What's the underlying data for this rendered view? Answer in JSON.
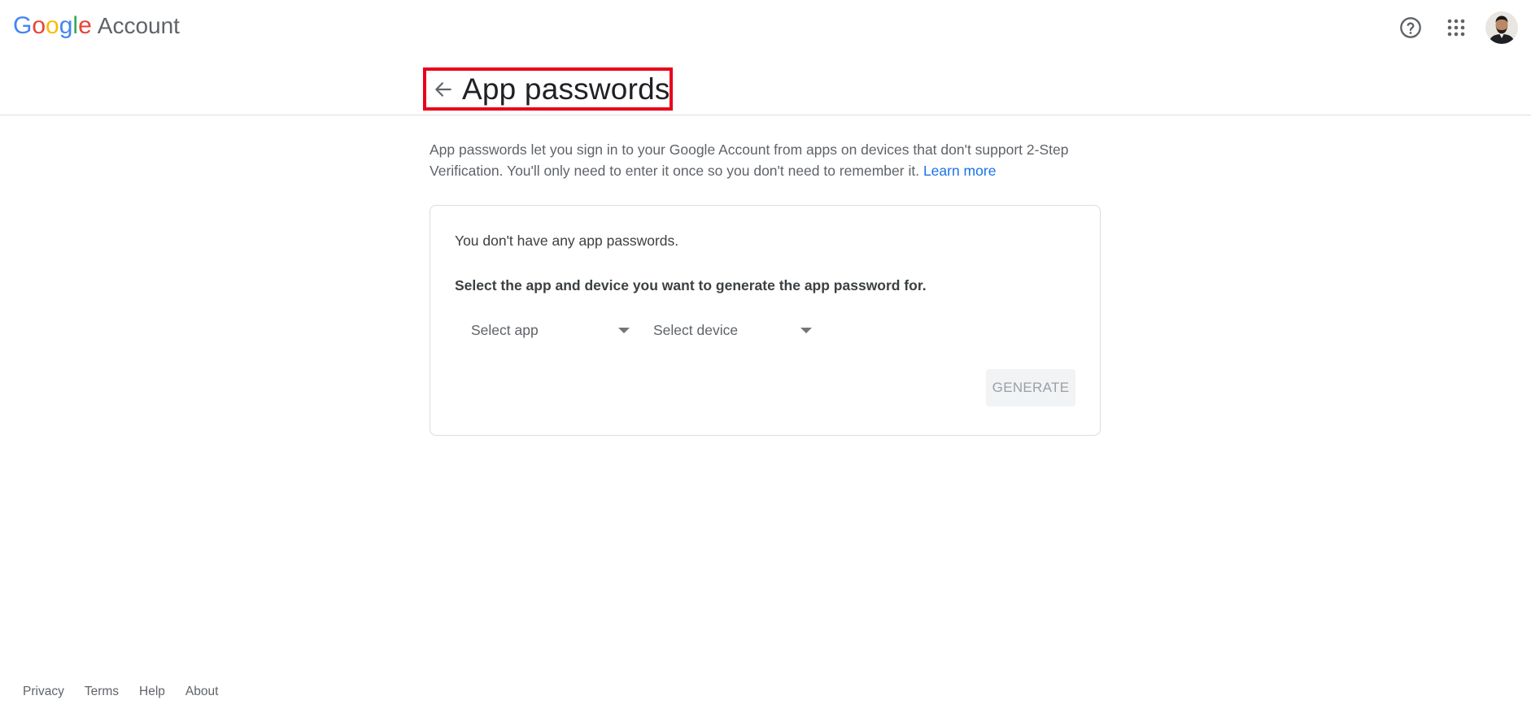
{
  "brand": {
    "letters": [
      {
        "char": "G",
        "color": "#4285F4"
      },
      {
        "char": "o",
        "color": "#EA4335"
      },
      {
        "char": "o",
        "color": "#FBBC05"
      },
      {
        "char": "g",
        "color": "#4285F4"
      },
      {
        "char": "l",
        "color": "#34A853"
      },
      {
        "char": "e",
        "color": "#EA4335"
      }
    ],
    "product": "Account"
  },
  "topbar": {
    "icons": [
      "help-icon",
      "apps-grid-icon",
      "avatar"
    ]
  },
  "header": {
    "title": "App passwords",
    "back_icon": "arrow-left-icon",
    "highlight_color": "#e8001c"
  },
  "main": {
    "description": "App passwords let you sign in to your Google Account from apps on devices that don't support 2-Step Verification. You'll only need to enter it once so you don't need to remember it.",
    "learn_more": "Learn more",
    "card": {
      "empty_message": "You don't have any app passwords.",
      "instruction": "Select the app and device you want to generate the app password for.",
      "select_app": "Select app",
      "select_device": "Select device",
      "generate_label": "GENERATE"
    }
  },
  "footer": {
    "links": [
      "Privacy",
      "Terms",
      "Help",
      "About"
    ]
  },
  "colors": {
    "link": "#1a73e8",
    "text_secondary": "#5f6368",
    "divider": "#dadce0"
  }
}
